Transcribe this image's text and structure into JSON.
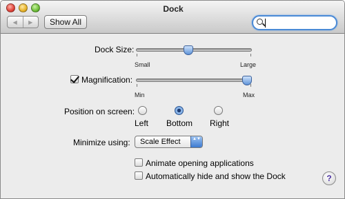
{
  "window": {
    "title": "Dock"
  },
  "toolbar": {
    "back_glyph": "◀",
    "forward_glyph": "▶",
    "show_all_label": "Show All",
    "search": {
      "value": "",
      "placeholder": ""
    }
  },
  "dock_size": {
    "label": "Dock Size:",
    "min_label": "Small",
    "max_label": "Large",
    "value_fraction": 0.45
  },
  "magnification": {
    "label": "Magnification:",
    "checked": true,
    "min_label": "Min",
    "max_label": "Max",
    "value_fraction": 1.0
  },
  "position": {
    "label": "Position on screen:",
    "options": [
      {
        "label": "Left",
        "selected": false
      },
      {
        "label": "Bottom",
        "selected": true
      },
      {
        "label": "Right",
        "selected": false
      }
    ]
  },
  "minimize": {
    "label": "Minimize using:",
    "value": "Scale Effect",
    "arrows": "▲▼"
  },
  "options": [
    {
      "label": "Animate opening applications",
      "checked": false
    },
    {
      "label": "Automatically hide and show the Dock",
      "checked": false
    }
  ],
  "help": {
    "glyph": "?"
  },
  "colors": {
    "accent": "#4a8ad6",
    "window_bg": "#ececec"
  }
}
